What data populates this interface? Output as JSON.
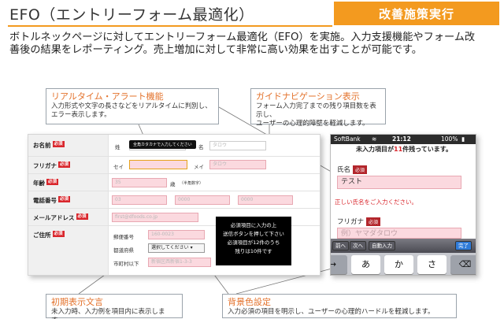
{
  "header": {
    "title": "EFO（エントリーフォーム最適化）",
    "badge": "改善施策実行"
  },
  "intro": "ボトルネックページに対してエントリーフォーム最適化（EFO）を実施。入力支援機能やフォーム改善後の結果をレポーティング。売上増加に対して非常に高い効果を出すことが可能です。",
  "callouts": {
    "realtime": {
      "title": "リアルタイム・アラート機能",
      "desc1": "入力形式や文字の長さなどをリアルタイムに判別し、",
      "desc2": "エラー表示します。"
    },
    "guide": {
      "title": "ガイドナビゲーション表示",
      "desc1": "フォーム入力完了までの残り項目数を表示し、",
      "desc2": "ユーザーの心理的障壁を軽減します。"
    },
    "initial": {
      "title": "初期表示文言",
      "desc": "未入力時、入力例を項目内に表示します。"
    },
    "bgcolor": {
      "title": "背景色設定",
      "desc": "入力必須の項目を明示し、ユーザーの心理的ハードルを軽減します。"
    }
  },
  "form": {
    "required_tag": "必須",
    "rows": {
      "name": {
        "label": "お名前",
        "sei": "姓",
        "mei": "名",
        "mei_placeholder": "タロウ",
        "tooltip": "全角カタカナで入力してください"
      },
      "kana": {
        "label": "フリガナ",
        "sei": "セイ",
        "mei": "メイ",
        "mei_placeholder": "タロウ"
      },
      "age": {
        "label": "年齢",
        "placeholder": "35",
        "unit": "歳",
        "note": "（半角数字）"
      },
      "tel": {
        "label": "電話番号",
        "p1": "03",
        "p2": "0000",
        "p3": "0000"
      },
      "email": {
        "label": "メールアドレス",
        "placeholder": "first@dfoods.co.jp"
      },
      "address": {
        "label": "ご住所",
        "zip_label": "郵便番号",
        "zip_placeholder": "160-0023",
        "pref_label": "都道府県",
        "pref_value": "選択してください",
        "city_label": "市町村以下",
        "city_placeholder": "新宿区西新宿1-3-3"
      }
    },
    "overlay": [
      "必須項目に入力の上",
      "送信ボタンを押して下さい",
      "必須項目が12件のうち",
      "残りは10件です"
    ]
  },
  "phone": {
    "carrier": "SoftBank",
    "time": "21:12",
    "battery": "100%",
    "notice_pre": "未入力項目が",
    "notice_count": "11",
    "notice_post": "件残っています。",
    "name_label": "氏名",
    "name_value": "テスト",
    "name_error": "正しい氏名をご入力ください。",
    "kana_label": "フリガナ",
    "kana_placeholder": "例）ヤマダタロウ",
    "req_tag": "必須",
    "toolbar": {
      "prev": "前へ",
      "next": "次へ",
      "autofill": "自動入力",
      "done": "完了"
    },
    "keys": [
      "→",
      "あ",
      "か",
      "さ",
      "⌫"
    ]
  }
}
